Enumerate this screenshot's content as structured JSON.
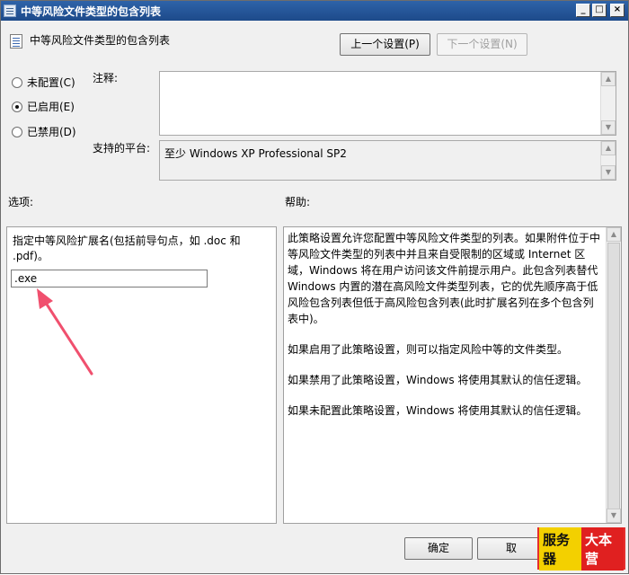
{
  "window": {
    "title": "中等风险文件类型的包含列表"
  },
  "header": {
    "policy_name": "中等风险文件类型的包含列表",
    "prev_label": "上一个设置(P)",
    "next_label": "下一个设置(N)"
  },
  "state": {
    "options": [
      {
        "label": "未配置(C)",
        "checked": false
      },
      {
        "label": "已启用(E)",
        "checked": true
      },
      {
        "label": "已禁用(D)",
        "checked": false
      }
    ]
  },
  "comment": {
    "label": "注释:",
    "value": ""
  },
  "platform": {
    "label": "支持的平台:",
    "value": "至少 Windows XP Professional SP2"
  },
  "options_panel": {
    "heading": "选项:",
    "description": "指定中等风险扩展名(包括前导句点，如 .doc 和 .pdf)。",
    "extension_value": ".exe"
  },
  "help_panel": {
    "heading": "帮助:",
    "paragraphs": [
      "此策略设置允许您配置中等风险文件类型的列表。如果附件位于中等风险文件类型的列表中并且来自受限制的区域或 Internet 区域，Windows 将在用户访问该文件前提示用户。此包含列表替代 Windows 内置的潜在高风险文件类型列表，它的优先顺序高于低风险包含列表但低于高风险包含列表(此时扩展名列在多个包含列表中)。",
      "如果启用了此策略设置，则可以指定风险中等的文件类型。",
      "如果禁用了此策略设置，Windows 将使用其默认的信任逻辑。",
      "如果未配置此策略设置，Windows 将使用其默认的信任逻辑。"
    ]
  },
  "footer": {
    "ok_label": "确定",
    "cancel_label": "取"
  },
  "watermark": {
    "part1": "服务器",
    "part2": "大本营"
  },
  "colors": {
    "titlebar": "#2e63a9",
    "annotation_arrow": "#f0506e",
    "watermark_border": "#e52d2d"
  }
}
